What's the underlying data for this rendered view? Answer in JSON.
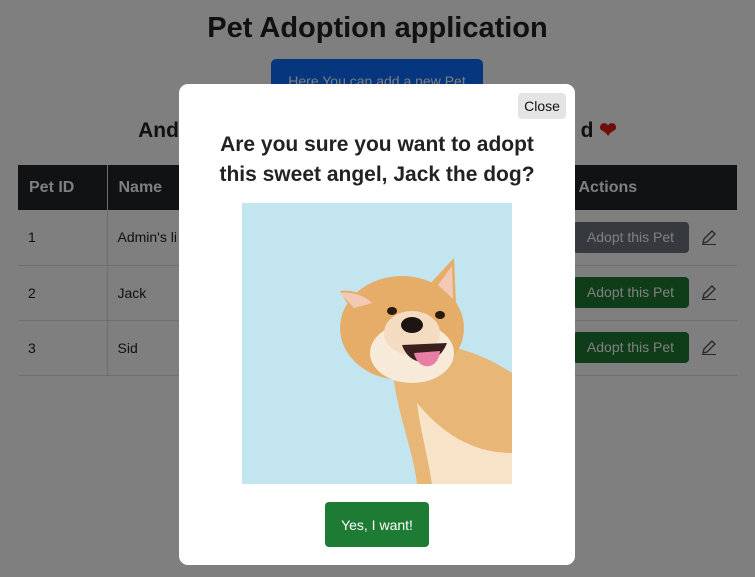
{
  "page": {
    "title": "Pet Adoption application",
    "add_button_label": "Here You can add a new Pet",
    "subtitle_left": "And l",
    "subtitle_right": "d",
    "heart": "❤"
  },
  "table": {
    "headers": [
      "Pet ID",
      "Name",
      "Actions"
    ],
    "rows": [
      {
        "id": "1",
        "name": "Admin's li",
        "action": "Adopt this Pet",
        "adoptable": false
      },
      {
        "id": "2",
        "name": "Jack",
        "action": "Adopt this Pet",
        "adoptable": true
      },
      {
        "id": "3",
        "name": "Sid",
        "action": "Adopt this Pet",
        "adoptable": true
      }
    ]
  },
  "modal": {
    "close_label": "Close",
    "question": "Are you sure you want to adopt this sweet angel, Jack the dog?",
    "confirm_label": "Yes, I want!"
  },
  "colors": {
    "primary_blue": "#0d6efd",
    "adopt_green": "#1e7b34",
    "disabled_gray": "#6c757d",
    "table_header": "#212529",
    "photo_background": "#c3e5ef"
  },
  "icons": [
    "pencil-icon",
    "heart-icon"
  ]
}
